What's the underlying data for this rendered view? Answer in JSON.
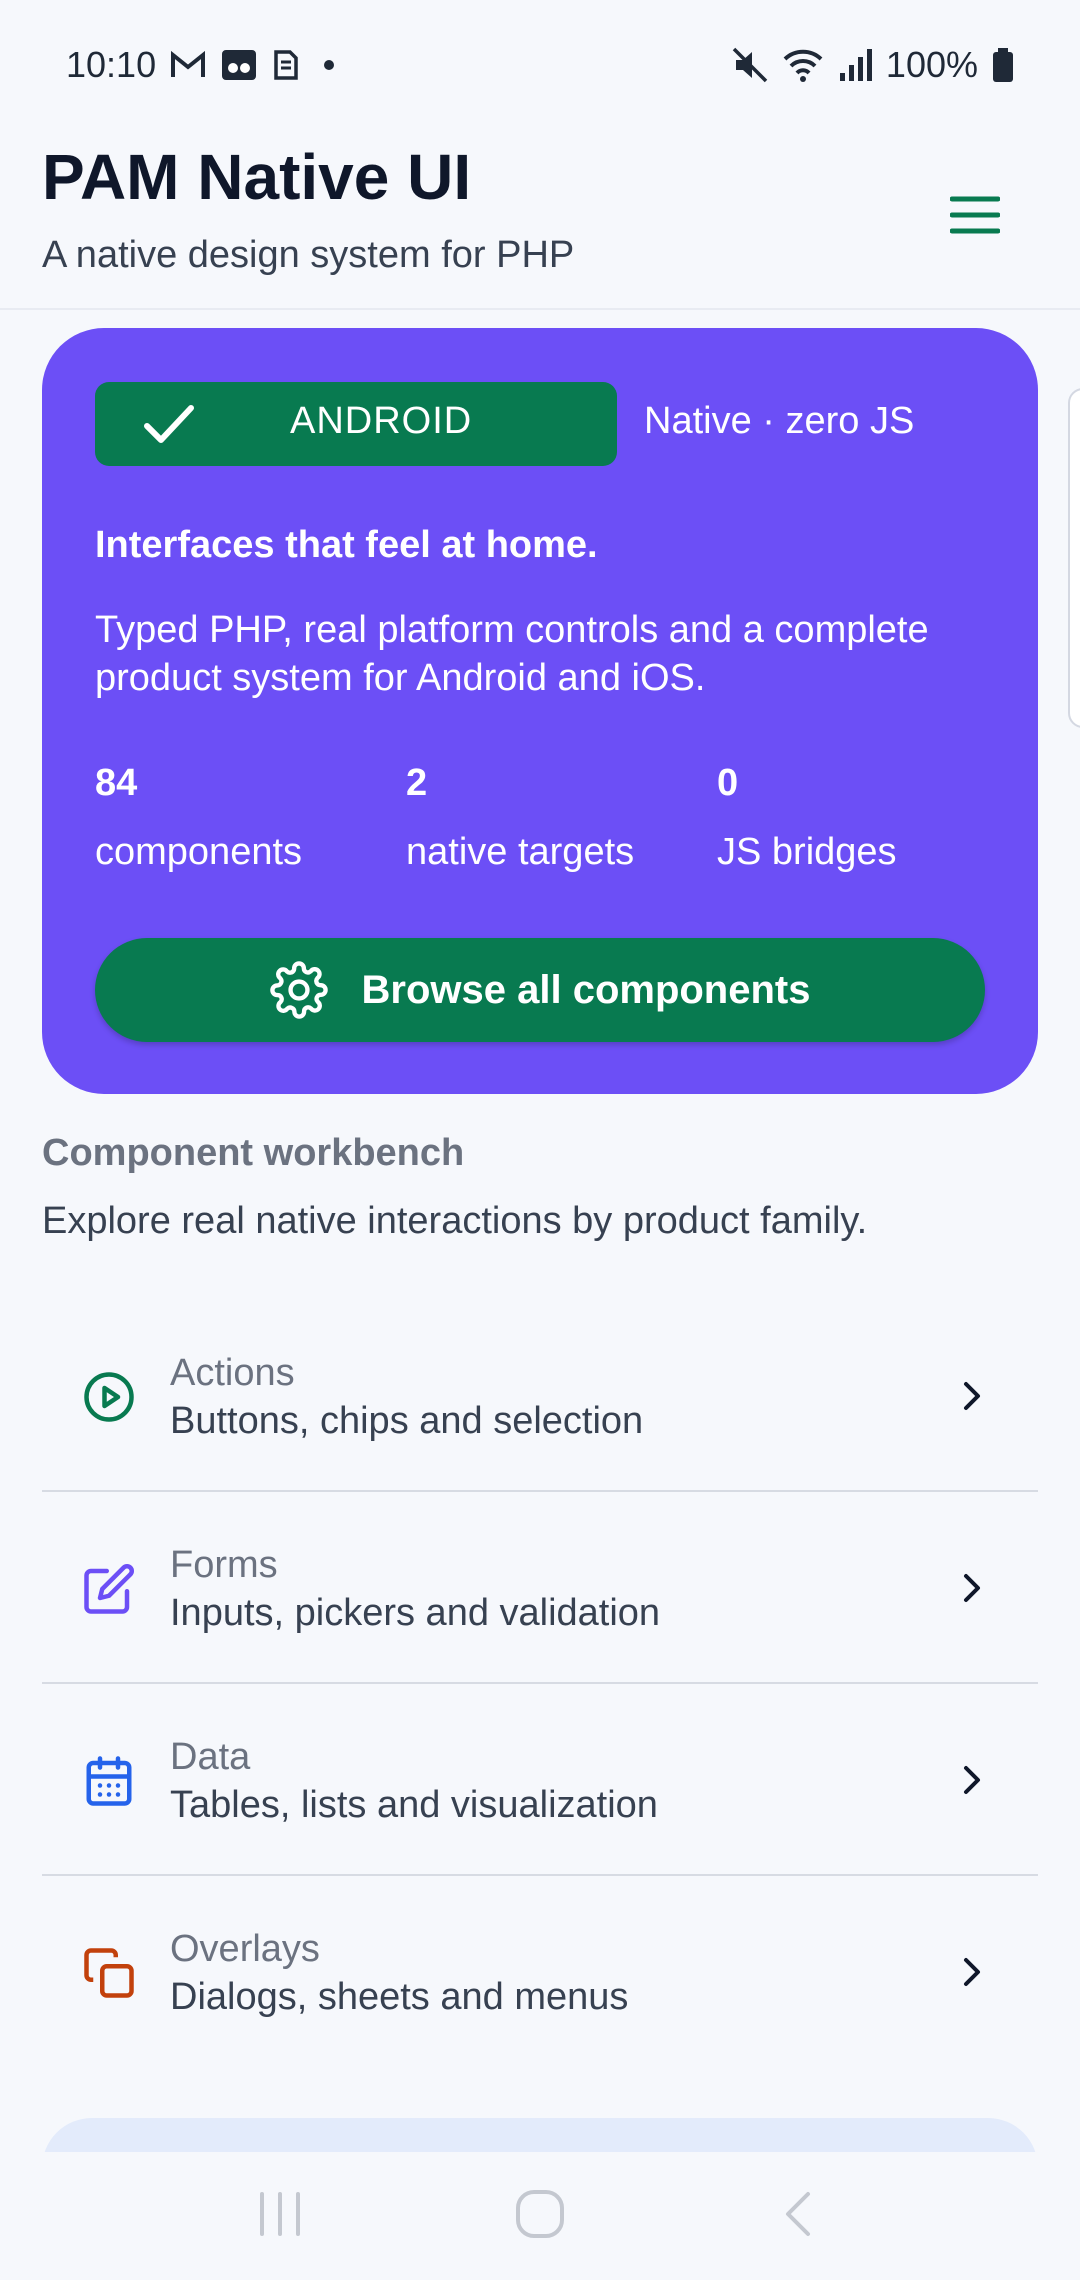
{
  "status": {
    "time": "10:10",
    "battery": "100%",
    "icons": [
      "gmail-icon",
      "voicemail-icon",
      "sim-icon",
      "dot-icon",
      "mute-icon",
      "wifi-icon",
      "signal-icon",
      "battery-icon"
    ]
  },
  "header": {
    "title": "PAM Native UI",
    "subtitle": "A native design system for PHP"
  },
  "hero": {
    "platform_label": "ANDROID",
    "native_tag": "Native · zero JS",
    "headline": "Interfaces that feel at home.",
    "description": "Typed PHP, real platform controls and a complete product system for Android and iOS.",
    "stats": [
      {
        "value": "84",
        "label": "components"
      },
      {
        "value": "2",
        "label": "native targets"
      },
      {
        "value": "0",
        "label": "JS bridges"
      }
    ],
    "cta_label": "Browse all components",
    "colors": {
      "background": "#6c4ff6",
      "accent": "#087a50"
    }
  },
  "workbench": {
    "title": "Component workbench",
    "description": "Explore real native interactions by product family.",
    "items": [
      {
        "title": "Actions",
        "desc": "Buttons, chips and selection",
        "icon": "play-circle-icon",
        "color": "#087a50"
      },
      {
        "title": "Forms",
        "desc": "Inputs, pickers and validation",
        "icon": "edit-icon",
        "color": "#6c4ff6"
      },
      {
        "title": "Data",
        "desc": "Tables, lists and visualization",
        "icon": "calendar-icon",
        "color": "#2563eb"
      },
      {
        "title": "Overlays",
        "desc": "Dialogs, sheets and menus",
        "icon": "copy-icon",
        "color": "#c2410c"
      }
    ]
  }
}
